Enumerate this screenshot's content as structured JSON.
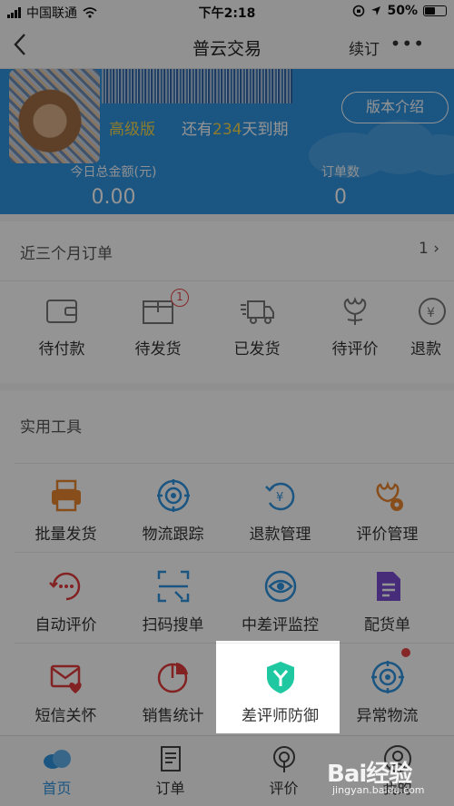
{
  "status_bar": {
    "carrier": "中国联通",
    "time": "下午2:18",
    "battery": "50%"
  },
  "nav": {
    "back_label": "<",
    "title": "普云交易",
    "renew_label": "续订",
    "more_label": "•••"
  },
  "account": {
    "level": "高级版",
    "expire_prefix": "还有",
    "expire_days": "234",
    "expire_suffix": "天到期",
    "intro_button": "版本介绍"
  },
  "stats": [
    {
      "label": "今日总金额(元)",
      "value": "0.00"
    },
    {
      "label": "订单数",
      "value": "0"
    }
  ],
  "orders": {
    "header": "近三个月订单",
    "count_label": "1 ›",
    "items": [
      {
        "label": "待付款",
        "icon": "wallet-icon"
      },
      {
        "label": "待发货",
        "icon": "package-icon",
        "badge": "1"
      },
      {
        "label": "已发货",
        "icon": "truck-icon"
      },
      {
        "label": "待评价",
        "icon": "flower-icon"
      },
      {
        "label": "退款",
        "icon": "refund-icon"
      }
    ]
  },
  "tools": {
    "header": "实用工具",
    "items": [
      {
        "label": "批量发货",
        "icon": "printer-icon",
        "color": "#e8862e"
      },
      {
        "label": "物流跟踪",
        "icon": "target-icon",
        "color": "#2f93e0"
      },
      {
        "label": "退款管理",
        "icon": "refund-yuan-icon",
        "color": "#2f93e0"
      },
      {
        "label": "评价管理",
        "icon": "gear-flower-icon",
        "color": "#e8862e"
      },
      {
        "label": "自动评价",
        "icon": "chat-dots-icon",
        "color": "#e23b3b"
      },
      {
        "label": "扫码搜单",
        "icon": "scan-icon",
        "color": "#2f93e0"
      },
      {
        "label": "中差评监控",
        "icon": "eye-icon",
        "color": "#2f93e0"
      },
      {
        "label": "配货单",
        "icon": "document-icon",
        "color": "#7a4fd0"
      },
      {
        "label": "短信关怀",
        "icon": "mail-heart-icon",
        "color": "#e23b3b"
      },
      {
        "label": "销售统计",
        "icon": "pie-chart-icon",
        "color": "#e23b3b"
      },
      {
        "label": "差评师防御",
        "icon": "shield-icon",
        "color": "#1fc8a0"
      },
      {
        "label": "异常物流",
        "icon": "target-icon",
        "color": "#2f93e0"
      }
    ]
  },
  "tabbar": [
    {
      "label": "首页",
      "icon": "home-cloud-icon",
      "active": true
    },
    {
      "label": "订单",
      "icon": "order-icon"
    },
    {
      "label": "评价",
      "icon": "broadcast-icon"
    },
    {
      "label": "我的",
      "icon": "user-icon"
    }
  ],
  "watermark": {
    "logo": "Bai经验",
    "url": "jingyan.baidu.com"
  }
}
